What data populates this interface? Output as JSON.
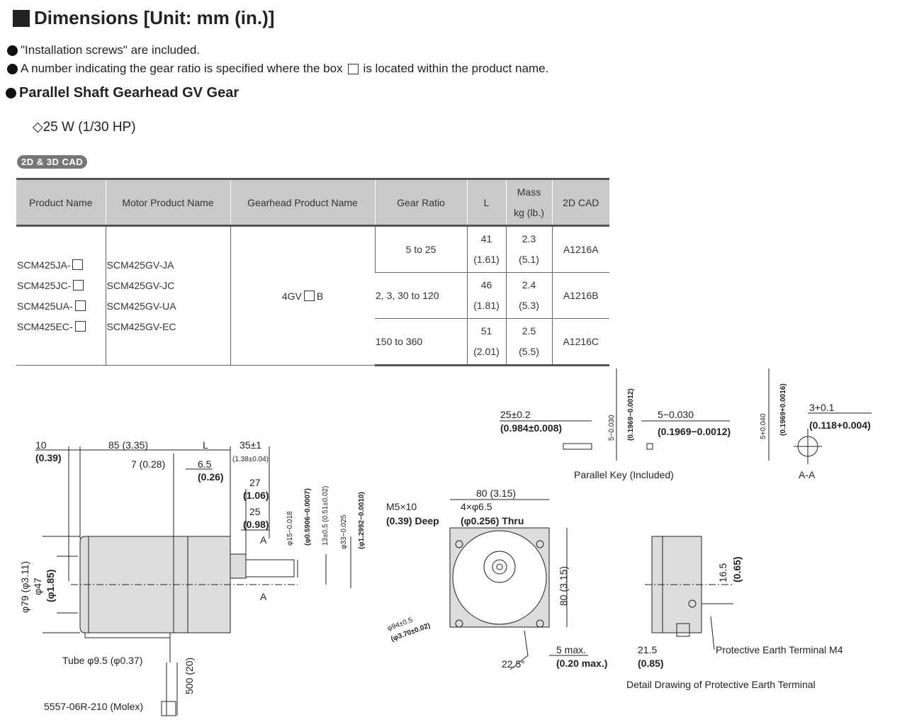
{
  "title": "Dimensions [Unit: mm (in.)]",
  "notes": [
    "\"Installation screws\" are included.",
    "A number indicating the gear ratio is specified where the box",
    "is located within the product name."
  ],
  "section": "Parallel Shaft Gearhead GV Gear",
  "power": "◇25 W (1/30 HP)",
  "cad_badge": "2D & 3D CAD",
  "table": {
    "headers": [
      "Product Name",
      "Motor Product Name",
      "Gearhead Product Name",
      "Gear Ratio",
      "L",
      "Mass",
      "kg (lb.)",
      "2D CAD"
    ],
    "product_names": [
      "SCM425JA-",
      "SCM425JC-",
      "SCM425UA-",
      "SCM425EC-"
    ],
    "motor_names": [
      "SCM425GV-JA",
      "SCM425GV-JC",
      "SCM425GV-UA",
      "SCM425GV-EC"
    ],
    "gearhead_pre": "4GV",
    "gearhead_post": "B",
    "rows": [
      {
        "ratio": "5 to 25",
        "L": "41",
        "L_in": "(1.61)",
        "mass": "2.3",
        "mass_lb": "(5.1)",
        "cad": "A1216A"
      },
      {
        "ratio": "2, 3, 30 to 120",
        "L": "46",
        "L_in": "(1.81)",
        "mass": "2.4",
        "mass_lb": "(5.3)",
        "cad": "A1216B"
      },
      {
        "ratio": "150 to 360",
        "L": "51",
        "L_in": "(2.01)",
        "mass": "2.5",
        "mass_lb": "(5.5)",
        "cad": "A1216C"
      }
    ]
  },
  "drawing": {
    "d10": "10",
    "d10in": "(0.39)",
    "d85": "85 (3.35)",
    "dL": "L",
    "d35": "35±1",
    "d35in": "(1.38±0.04)",
    "d7": "7 (0.28)",
    "d65": "6.5",
    "d65in": "(0.26)",
    "d27": "27",
    "d27in": "(1.06)",
    "d25": "25",
    "d25in": "(0.98)",
    "secA": "A",
    "phi15": "φ15−0.018",
    "phi15in": "(φ0.5906−0.0007)",
    "d13": "13±0.5 (0.51±0.02)",
    "phi33": "φ33−0.025",
    "phi33in": "(φ1.2992−0.0010)",
    "phi79": "φ79 (φ3.11)",
    "phi47": "φ47",
    "phi47in": "(φ1.85)",
    "tube": "Tube φ9.5 (φ0.37)",
    "conn": "5557-06R-210 (Molex)",
    "d500": "500 (20)",
    "m5": "M5×10",
    "m5in": "(0.39) Deep",
    "holes": "4×φ6.5",
    "holesin": "(φ0.256) Thru",
    "d80top": "80 (3.15)",
    "d80side": "80 (3.15)",
    "phi94": "φ94±0.5",
    "phi94in": "(φ3.70±0.02)",
    "ang": "22.5°",
    "d5max": "5 max.",
    "d5maxin": "(0.20 max.)",
    "d16": "16.5",
    "d16in": "(0.65)",
    "d21": "21.5",
    "d21in": "(0.85)",
    "pe": "Protective Earth Terminal M4",
    "pe_caption": "Detail Drawing of Protective Earth Terminal",
    "k25": "25±0.2",
    "k25in": "(0.984±0.008)",
    "k5v": "5−0.030",
    "k5vin": "(0.1969−0.0012)",
    "k5": "5−0.030",
    "k5in": "(0.1969−0.0012)",
    "key_caption": "Parallel Key (Included)",
    "a5": "5+0.040",
    "a5in": "(0.1969+0.0016)",
    "a3": "3+0.1",
    "a3in": "(0.118+0.004)",
    "aa_caption": "A-A"
  }
}
